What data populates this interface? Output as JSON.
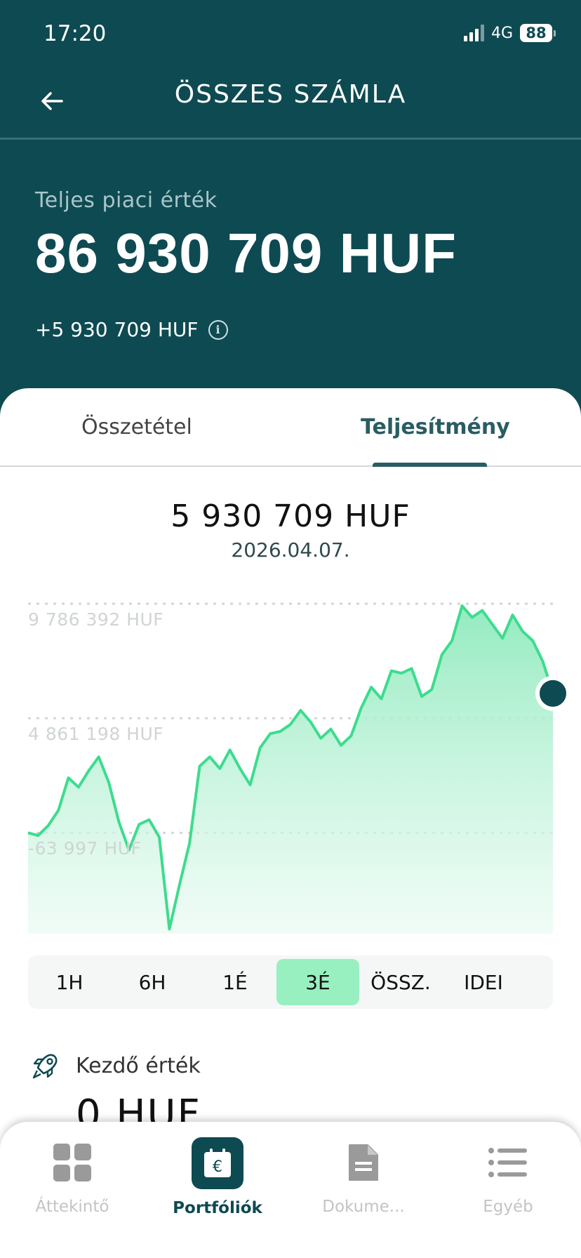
{
  "status": {
    "time": "17:20",
    "network": "4G",
    "battery": "88"
  },
  "header": {
    "title": "ÖSSZES SZÁMLA"
  },
  "hero": {
    "label": "Teljes piaci érték",
    "value": "86 930 709 HUF",
    "change": "+5 930 709 HUF"
  },
  "tabs": [
    {
      "label": "Összetétel",
      "active": false
    },
    {
      "label": "Teljesítmény",
      "active": true
    }
  ],
  "performance": {
    "value": "5 930 709 HUF",
    "date": "2026.04.07."
  },
  "chart_data": {
    "type": "area",
    "y_ticks": [
      "9 786 392 HUF",
      "4 861 198 HUF",
      "-63 997 HUF"
    ],
    "ylim": [
      -4400000,
      9786392
    ],
    "grid": true,
    "line_color": "#3ddc8e",
    "fill_color": "#b5f2d3",
    "values": [
      -63997,
      -180000,
      250000,
      900000,
      2300000,
      1900000,
      2600000,
      3200000,
      2100000,
      400000,
      -800000,
      300000,
      500000,
      -250000,
      -4200000,
      -2300000,
      -500000,
      2800000,
      3200000,
      2700000,
      3500000,
      2700000,
      2000000,
      3600000,
      4200000,
      4300000,
      4600000,
      5200000,
      4700000,
      4000000,
      4400000,
      3700000,
      4100000,
      5300000,
      6200000,
      5700000,
      6900000,
      6800000,
      7000000,
      5800000,
      6100000,
      7600000,
      8200000,
      9700000,
      9200000,
      9500000,
      8900000,
      8300000,
      9300000,
      8600000,
      8200000,
      7300000,
      5930709
    ]
  },
  "ranges": [
    {
      "label": "1H",
      "active": false
    },
    {
      "label": "6H",
      "active": false
    },
    {
      "label": "1É",
      "active": false
    },
    {
      "label": "3É",
      "active": true
    },
    {
      "label": "ÖSSZ.",
      "active": false
    },
    {
      "label": "IDEI",
      "active": false
    }
  ],
  "start_value": {
    "label": "Kezdő érték",
    "value": "0 HUF"
  },
  "nav": [
    {
      "label": "Áttekintő",
      "icon": "grid-icon",
      "active": false
    },
    {
      "label": "Portfóliók",
      "icon": "euro-calendar-icon",
      "active": true
    },
    {
      "label": "Dokume...",
      "icon": "document-icon",
      "active": false
    },
    {
      "label": "Egyéb",
      "icon": "list-icon",
      "active": false
    }
  ],
  "colors": {
    "brand": "#0e4a52",
    "accent": "#3ddc8e",
    "range_active": "#98f0c0"
  }
}
